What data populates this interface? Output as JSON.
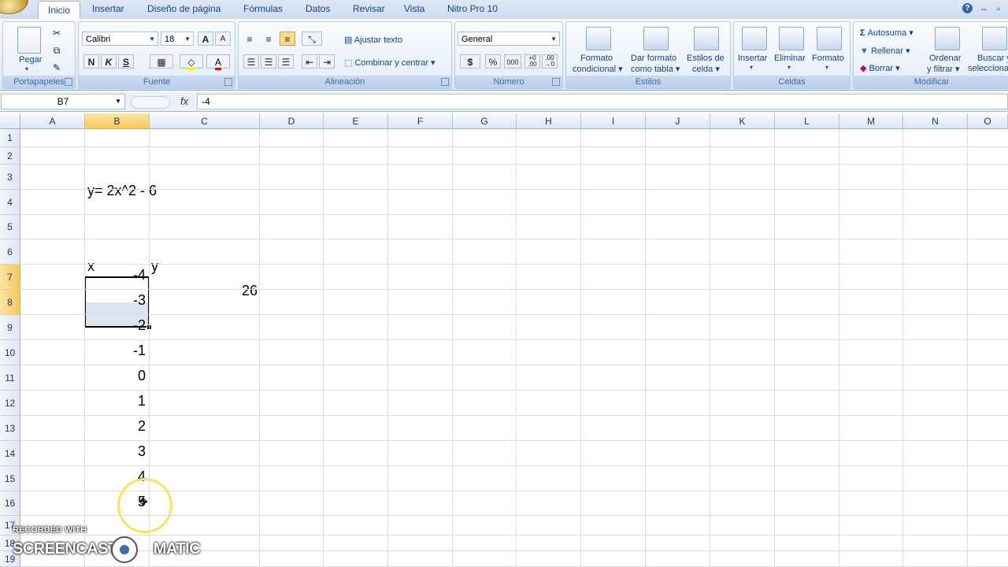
{
  "ribbon": {
    "tabs": [
      "Inicio",
      "Insertar",
      "Diseño de página",
      "Fórmulas",
      "Datos",
      "Revisar",
      "Vista",
      "Nitro Pro 10"
    ],
    "groups": {
      "portapapeles": {
        "label": "Portapapeles",
        "paste": "Pegar"
      },
      "fuente": {
        "label": "Fuente",
        "font": "Calibri",
        "size": "18",
        "bold": "N",
        "italic": "K",
        "underline": "S",
        "grow": "A",
        "shrink": "A",
        "fontcolor": "A"
      },
      "alineacion": {
        "label": "Alineación",
        "wrap": "Ajustar texto",
        "merge": "Combinar y centrar"
      },
      "numero": {
        "label": "Número",
        "format": "General",
        "currency": "$",
        "percent": "%",
        "thousands": "000",
        "inc_dec": ",0\n.00",
        "dec_dec": ",00\n,0"
      },
      "estilos": {
        "label": "Estilos",
        "cond_1": "Formato",
        "cond_2": "condicional",
        "table_1": "Dar formato",
        "table_2": "como tabla",
        "cell_1": "Estilos de",
        "cell_2": "celda"
      },
      "celdas": {
        "label": "Celdas",
        "insert": "Insertar",
        "delete": "Eliminar",
        "format": "Formato"
      },
      "modificar": {
        "label": "Modificar",
        "autosum": "Autosuma",
        "fill": "Rellenar",
        "clear": "Borrar",
        "sort_1": "Ordenar",
        "sort_2": "y filtrar",
        "find_1": "Buscar y",
        "find_2": "seleccionar"
      }
    }
  },
  "formula_bar": {
    "name_box": "B7",
    "fx": "fx",
    "formula": "-4"
  },
  "columns": [
    "A",
    "B",
    "C",
    "D",
    "E",
    "F",
    "G",
    "H",
    "I",
    "J",
    "K",
    "L",
    "M",
    "N",
    "O"
  ],
  "rows": [
    "1",
    "2",
    "3",
    "4",
    "5",
    "6",
    "7",
    "8",
    "9",
    "10",
    "11",
    "12",
    "13",
    "14",
    "15",
    "16",
    "17",
    "18",
    "19"
  ],
  "cells": {
    "b3": "y= 2x^2 - 6",
    "b6": "x",
    "c6": "y",
    "c7": "26",
    "b_values": [
      "-4",
      "-3",
      "-2",
      "-1",
      "0",
      "1",
      "2",
      "3",
      "4",
      "5"
    ]
  },
  "watermark": {
    "line1": "RECORDED WITH",
    "line2_a": "SCREENCAST",
    "line2_b": "MATIC"
  },
  "colors": {
    "selection_header": "#f8c75c",
    "ribbon_text": "#15428b",
    "cursor_ring": "#f2e65a"
  }
}
